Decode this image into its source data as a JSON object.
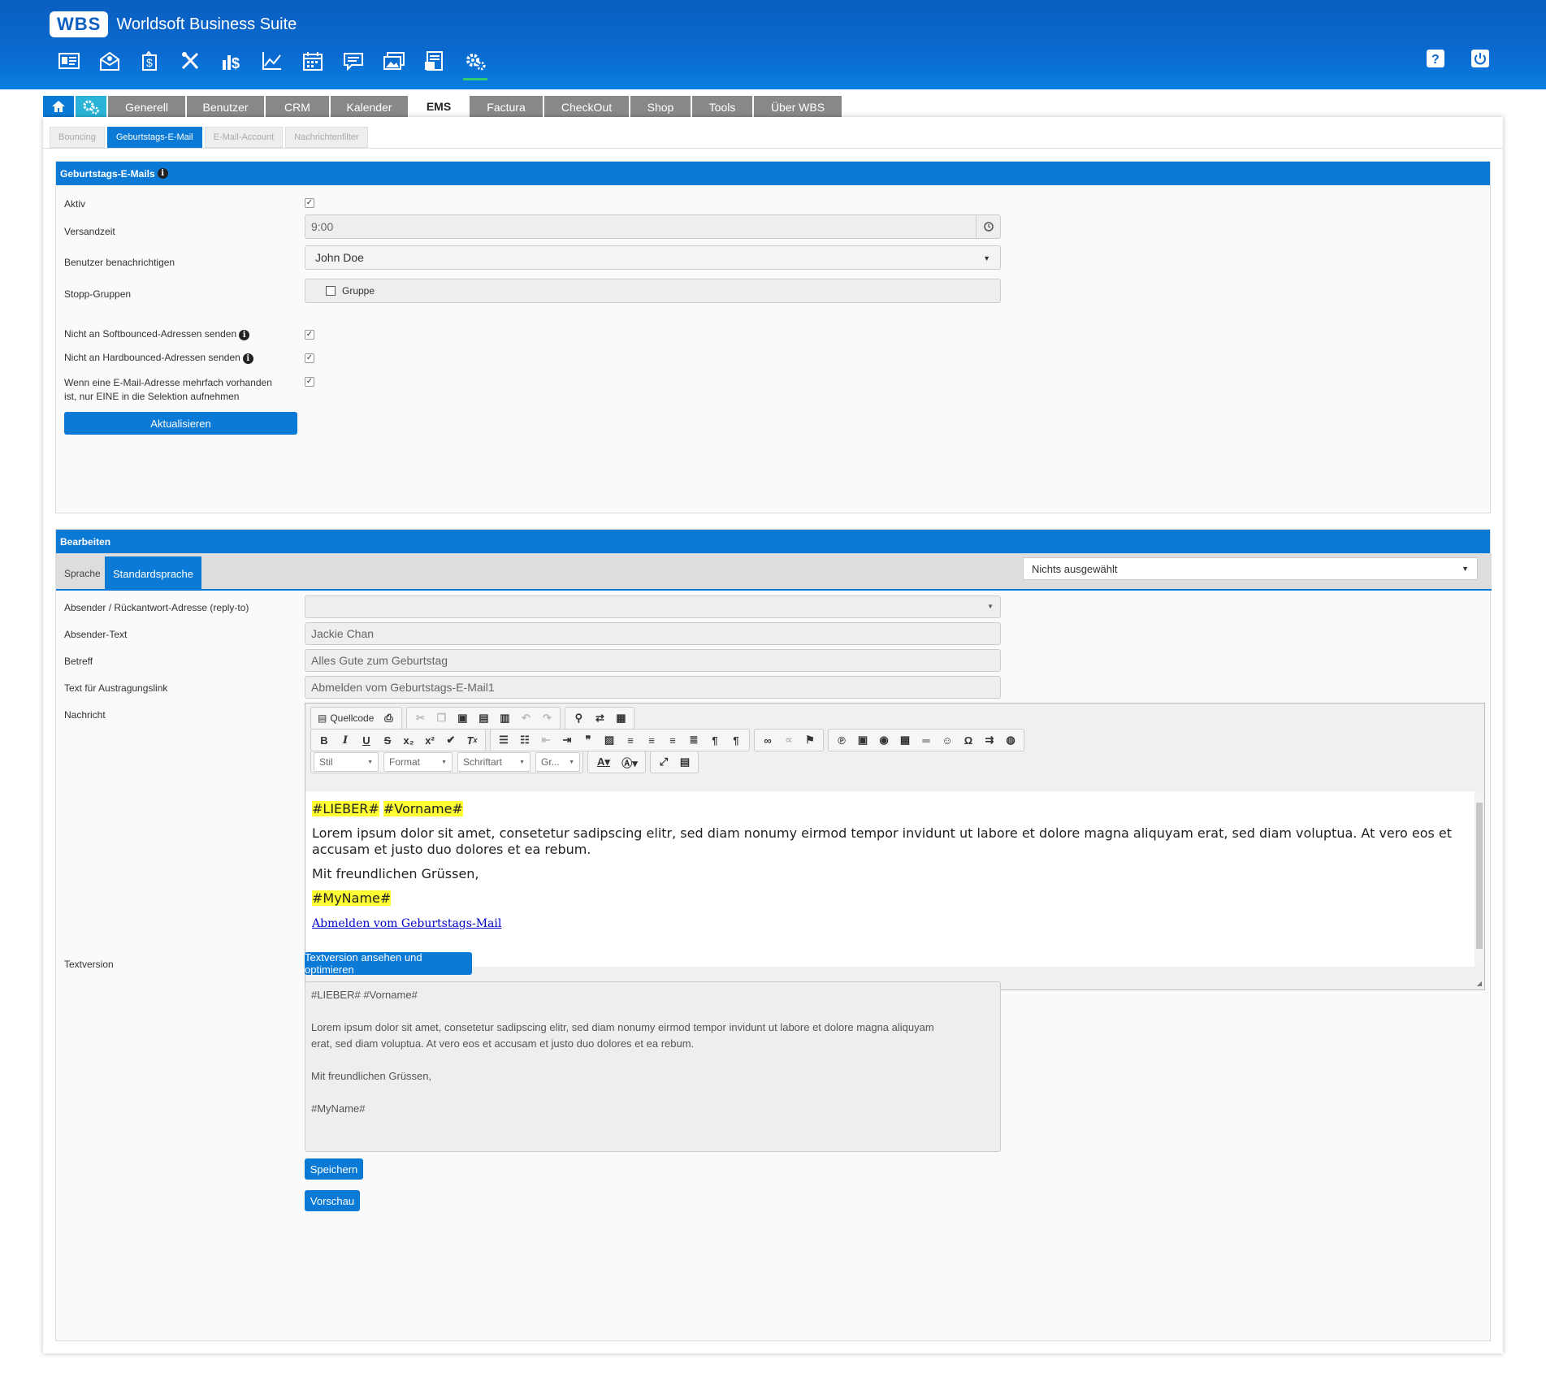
{
  "app": {
    "logo": "WBS",
    "title": "Worldsoft Business Suite"
  },
  "top_icons": [
    "contacts-card-icon",
    "mail-icon",
    "money-bag-icon",
    "tools-icon",
    "revenue-icon",
    "chart-icon",
    "calendar-icon",
    "message-icon",
    "images-icon",
    "newsletter-icon",
    "settings-gears-icon"
  ],
  "main_tabs": [
    {
      "label": "Generell"
    },
    {
      "label": "Benutzer"
    },
    {
      "label": "CRM"
    },
    {
      "label": "Kalender"
    },
    {
      "label": "EMS"
    },
    {
      "label": "Factura"
    },
    {
      "label": "CheckOut"
    },
    {
      "label": "Shop"
    },
    {
      "label": "Tools"
    },
    {
      "label": "Über WBS"
    }
  ],
  "sub_tabs": [
    {
      "label": "Bouncing"
    },
    {
      "label": "Geburtstags-E-Mail"
    },
    {
      "label": "E-Mail-Account"
    },
    {
      "label": "Nachrichtenfilter"
    }
  ],
  "section1": {
    "title": "Geburtstags-E-Mails",
    "aktiv_label": "Aktiv",
    "versandzeit_label": "Versandzeit",
    "versandzeit_value": "9:00",
    "benutzer_label": "Benutzer benachrichtigen",
    "benutzer_value": "John Doe",
    "stopp_label": "Stopp-Gruppen",
    "stopp_option": "Gruppe",
    "soft_label": "Nicht an Softbounced-Adressen senden",
    "hard_label": "Nicht an Hardbounced-Adressen senden",
    "dup_label_1": "Wenn eine E-Mail-Adresse mehrfach vorhanden",
    "dup_label_2": "ist, nur EINE in die Selektion aufnehmen",
    "update_button": "Aktualisieren"
  },
  "section2": {
    "title": "Bearbeiten",
    "lang_label": "Sprache",
    "lang_tab": "Standardsprache",
    "lang_select": "Nichts ausgewählt",
    "absender_label": "Absender / Rückantwort-Adresse (reply-to)",
    "absender_text_label": "Absender-Text",
    "absender_text_value": "Jackie Chan",
    "betreff_label": "Betreff",
    "betreff_value": "Alles Gute zum Geburtstag",
    "austrag_label": "Text für Austragungslink",
    "austrag_value": "Abmelden vom Geburtstags-E-Mail1",
    "nachricht_label": "Nachricht",
    "toolbar": {
      "source": "Quellcode",
      "style": "Stil",
      "format": "Format",
      "font": "Schriftart",
      "size": "Gr..."
    },
    "body": {
      "tag1": "#LIEBER#",
      "tag2": "#Vorname#",
      "paragraph": "Lorem ipsum dolor sit amet, consetetur sadipscing elitr, sed diam nonumy eirmod tempor invidunt ut labore et dolore magna aliquyam erat, sed diam voluptua. At vero eos et accusam et justo duo dolores et ea rebum.",
      "greeting": "Mit freundlichen Grüssen,",
      "name_tag": "#MyName#",
      "link": "Abmelden vom Geburtstags-Mail"
    },
    "textversion_label": "Textversion",
    "textversion_button": "Textversion ansehen und optimieren",
    "textversion_value": "#LIEBER# #Vorname#\n\nLorem ipsum dolor sit amet, consetetur sadipscing elitr, sed diam nonumy eirmod tempor invidunt ut labore et dolore magna aliquyam\nerat, sed diam voluptua. At vero eos et accusam et justo duo dolores et ea rebum.\n\nMit freundlichen Grüssen,\n\n#MyName#",
    "save_button": "Speichern",
    "preview_button": "Vorschau"
  },
  "colors": {
    "accent": "#0a7ad6",
    "topbar": "#0a6ad0",
    "highlight": "#ffff33"
  }
}
